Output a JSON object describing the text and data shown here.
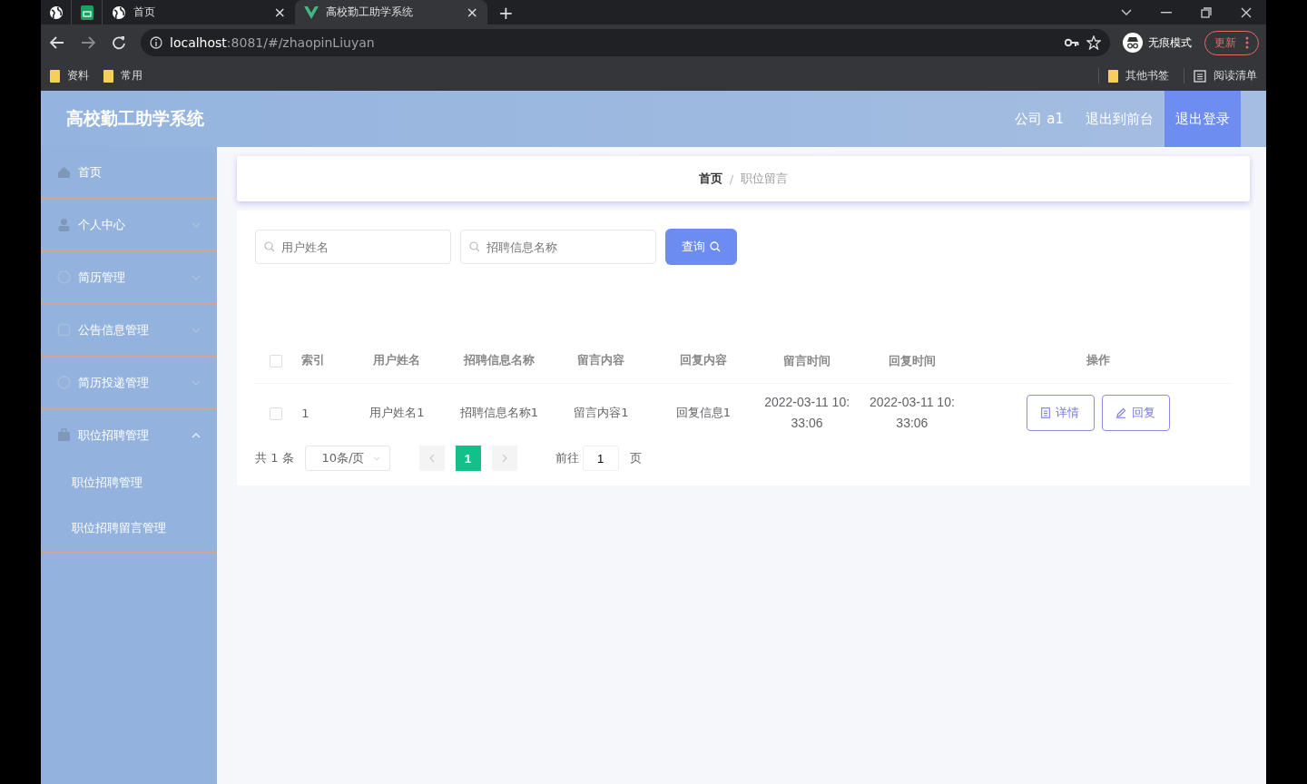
{
  "browser": {
    "tabs": [
      {
        "kind": "pinned",
        "selected": false
      },
      {
        "kind": "pinned",
        "selected": false
      },
      {
        "kind": "page",
        "title": "首页",
        "close": "×",
        "selected": false
      },
      {
        "kind": "page",
        "title": "高校勤工助学系统",
        "close": "×",
        "selected": true
      }
    ],
    "new_tab": "+",
    "address": {
      "host": "localhost",
      "path": ":8081/#/zhaopinLiuyan"
    },
    "profile": "无痕模式",
    "update": "更新",
    "bookmarks_left": [
      "资料",
      "常用"
    ],
    "bookmarks_right": [
      "其他书签",
      "阅读清单"
    ]
  },
  "header": {
    "title": "高校勤工助学系统",
    "links": [
      {
        "text": "公司 a1",
        "highlighted": false
      },
      {
        "text": "退出到前台",
        "highlighted": false
      },
      {
        "text": "退出登录",
        "highlighted": true
      }
    ]
  },
  "sidebar": {
    "items": [
      {
        "label": "首页"
      },
      {
        "label": "个人中心",
        "expanded": false
      },
      {
        "label": "简历管理",
        "expanded": false
      },
      {
        "label": "公告信息管理",
        "expanded": false
      },
      {
        "label": "简历投递管理",
        "expanded": false
      },
      {
        "label": "职位招聘管理",
        "expanded": true,
        "children": [
          {
            "label": "职位招聘管理"
          },
          {
            "label": "职位招聘留言管理"
          }
        ]
      }
    ]
  },
  "breadcrumb": {
    "items": [
      "首页",
      "职位留言"
    ],
    "separator": "/"
  },
  "search": {
    "fields": [
      {
        "placeholder": "用户姓名"
      },
      {
        "placeholder": "招聘信息名称"
      }
    ],
    "button": "查询"
  },
  "table": {
    "select_all_checked": false,
    "columns": [
      "索引",
      "用户姓名",
      "招聘信息名称",
      "留言内容",
      "回复内容",
      "留言时间",
      "回复时间",
      "操作"
    ],
    "rows": [
      {
        "checked": false,
        "cells": [
          "1",
          "用户姓名1",
          "招聘信息名称1",
          "留言内容1",
          "回复信息1",
          "2022-03-11 10:33:06",
          "2022-03-11 10:33:06"
        ],
        "actions": [
          {
            "label": "详情"
          },
          {
            "label": "回复"
          }
        ]
      }
    ]
  },
  "pagination": {
    "total": "共 1 条",
    "page_size": "10条/页",
    "pages": [
      {
        "label": "1",
        "selected": true
      }
    ],
    "goto_label": "前往",
    "goto_value": "1",
    "goto_unit": "页"
  }
}
